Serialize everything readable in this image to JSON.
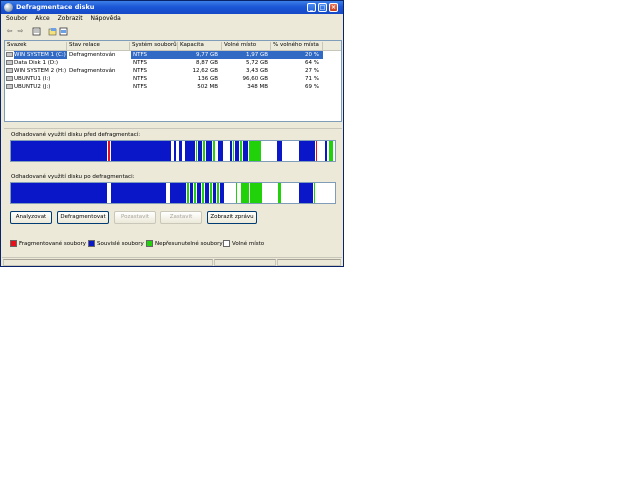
{
  "window": {
    "title": "Defragmentace disku"
  },
  "menu": [
    {
      "label": "Soubor"
    },
    {
      "label": "Akce"
    },
    {
      "label": "Zobrazit"
    },
    {
      "label": "Nápověda"
    }
  ],
  "toolbar": {
    "icons": [
      "back-arrow-icon",
      "forward-arrow-icon",
      "properties-icon",
      "help-icon",
      "console-icon"
    ]
  },
  "columns": [
    "Svazek",
    "Stav relace",
    "Systém souborů",
    "Kapacita",
    "Volné místo",
    "% volného místa"
  ],
  "rows": [
    {
      "volume": "WIN SYSTEM 1 (C:)",
      "status": "Defragmentován",
      "fs": "NTFS",
      "capacity": "9,77 GB",
      "free": "1,97 GB",
      "pct": "20 %",
      "selected": true
    },
    {
      "volume": "Data Disk 1 (D:)",
      "status": "",
      "fs": "NTFS",
      "capacity": "8,87 GB",
      "free": "5,72 GB",
      "pct": "64 %",
      "selected": false
    },
    {
      "volume": "WIN SYSTEM 2 (H:)",
      "status": "Defragmentován",
      "fs": "NTFS",
      "capacity": "12,62 GB",
      "free": "3,43 GB",
      "pct": "27 %",
      "selected": false
    },
    {
      "volume": "UBUNTU1 (I:)",
      "status": "",
      "fs": "NTFS",
      "capacity": "136 GB",
      "free": "96,60 GB",
      "pct": "71 %",
      "selected": false
    },
    {
      "volume": "UBUNTU2 (J:)",
      "status": "",
      "fs": "NTFS",
      "capacity": "502 MB",
      "free": "348 MB",
      "pct": "69 %",
      "selected": false
    }
  ],
  "before_label": "Odhadované využití disku před defragmentací:",
  "after_label": "Odhadované využití disku po defragmentaci:",
  "buttons": [
    {
      "label": "Analyzovat",
      "enabled": true
    },
    {
      "label": "Defragmentovat",
      "enabled": true
    },
    {
      "label": "Pozastavit",
      "enabled": false
    },
    {
      "label": "Zastavit",
      "enabled": false
    },
    {
      "label": "Zobrazit zprávu",
      "enabled": true
    }
  ],
  "legend": [
    {
      "label": "Fragmentované soubory",
      "color": "#e8101a"
    },
    {
      "label": "Souvislé soubory",
      "color": "#0a17c8"
    },
    {
      "label": "Nepřesunutelné soubory",
      "color": "#21d10a"
    },
    {
      "label": "Volné místo",
      "color": "#ffffff"
    }
  ],
  "colors": {
    "fragmented": "#e8101a",
    "contiguous": "#0a17c8",
    "unmovable": "#21d10a",
    "free": "#ffffff"
  }
}
